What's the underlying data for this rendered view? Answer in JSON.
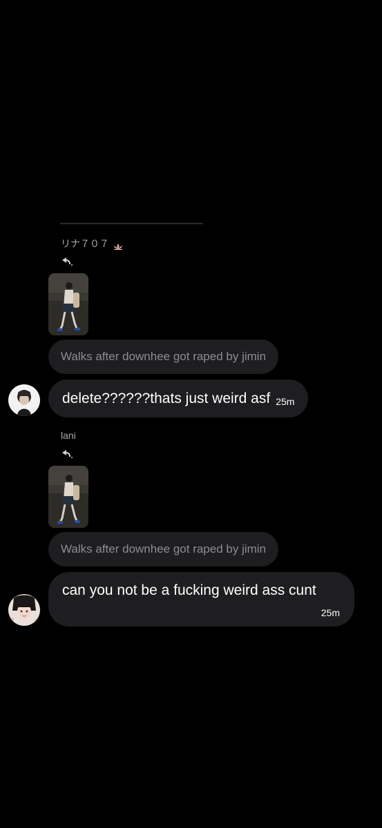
{
  "thread": {
    "messages": [
      {
        "sender": "リナ７０７",
        "reply_icon": "reply-arrow-icon",
        "attachment": "thumbnail-image",
        "quote": "Walks after downhee got raped by jimin",
        "text": "delete??????thats just weird asf",
        "time": "25m",
        "avatar": "avatar-image"
      },
      {
        "sender": "lani",
        "reply_icon": "reply-arrow-icon",
        "attachment": "thumbnail-image",
        "quote": "Walks after downhee got raped by jimin",
        "text": "can you not be a fucking weird ass cunt",
        "time": "25m",
        "avatar": "avatar-image"
      }
    ]
  },
  "colors": {
    "background": "#000000",
    "bubble": "#1e1e20",
    "quote_text": "#8d8d92",
    "sender_text": "#a9a9ae",
    "message_text": "#ffffff"
  }
}
